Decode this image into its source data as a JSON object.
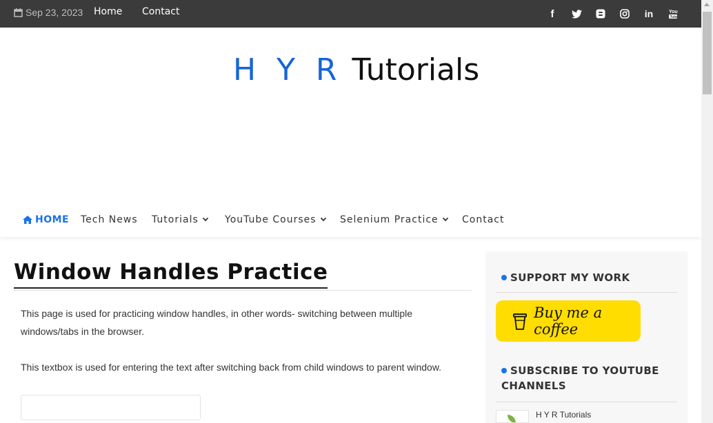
{
  "topbar": {
    "date": "Sep 23, 2023",
    "links": [
      "Home",
      "Contact"
    ],
    "social_icons": [
      "facebook-icon",
      "twitter-icon",
      "blogger-icon",
      "instagram-icon",
      "linkedin-icon",
      "youtube-icon"
    ],
    "social_glyphs": [
      "f",
      "🐦",
      "B",
      "◎",
      "in",
      "▶"
    ]
  },
  "logo": {
    "part1": "H Y R",
    "part2": "Tutorials"
  },
  "nav": {
    "items": [
      {
        "label": "HOME",
        "icon": "home-icon"
      },
      {
        "label": "Tech News"
      },
      {
        "label": "Tutorials"
      },
      {
        "label": "YouTube Courses"
      },
      {
        "label": "Selenium Practice"
      },
      {
        "label": "Contact"
      }
    ]
  },
  "main": {
    "title": "Window Handles Practice",
    "intro": "This page is used for practicing window handles, in other words- switching between multiple windows/tabs in the browser.",
    "textbox_desc": "This textbox is used for entering the text after switching back from child windows to parent window.",
    "textbox_value": ""
  },
  "sidebar": {
    "support_title": "SUPPORT MY WORK",
    "coffee_label": "Buy me a coffee",
    "subscribe_title": "SUBSCRIBE TO YOUTUBE CHANNELS",
    "channel_name": "H Y R Tutorials"
  },
  "colors": {
    "accent": "#1a73e8",
    "topbar_bg": "#3b3b3b",
    "coffee_bg": "#ffdd00",
    "logo_blue": "#1565d8"
  }
}
